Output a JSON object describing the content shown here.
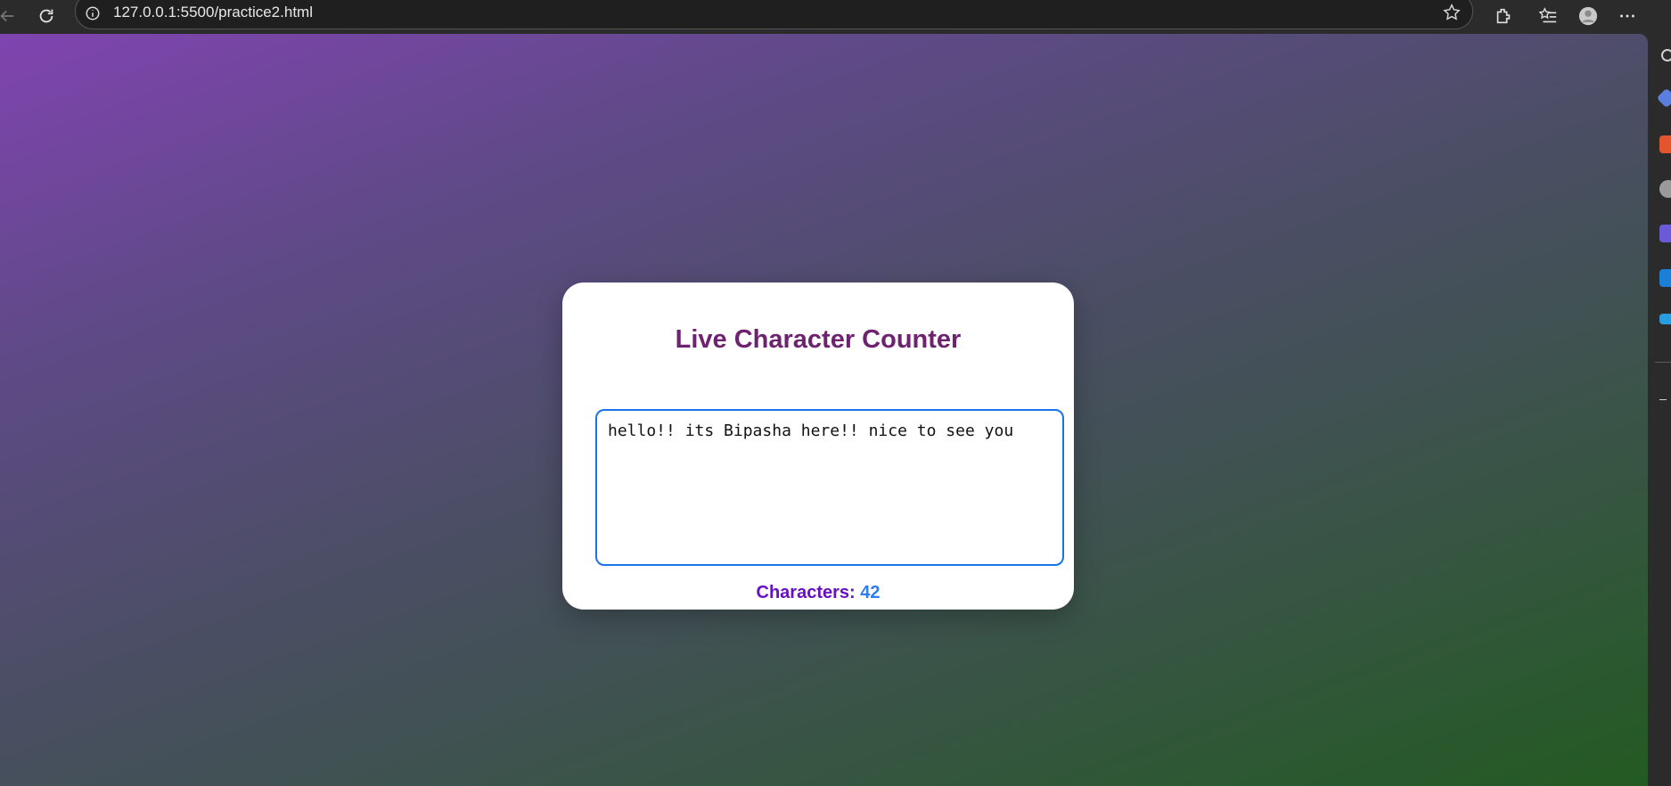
{
  "browser": {
    "url": "127.0.0.1:5500/practice2.html"
  },
  "page": {
    "title": "Live Character Counter",
    "textarea_value": "hello!! its Bipasha here!! nice to see you",
    "counter_label": "Characters:",
    "counter_value": "42"
  },
  "colors": {
    "title": "#6e2370",
    "counter_label": "#6610c4",
    "counter_value": "#2f7cf0",
    "textarea_border": "#1a73e8",
    "gradient_start": "#8044b0",
    "gradient_end": "#235a22"
  },
  "icons": {
    "toolbar": [
      "back-icon",
      "reload-icon",
      "info-icon",
      "star-icon",
      "extensions-icon",
      "favorites-icon",
      "profile-icon",
      "more-icon"
    ],
    "sidebar": [
      "search-icon",
      "copilot-icon",
      "shopping-icon",
      "people-icon",
      "games-icon",
      "outlook-icon",
      "send-icon",
      "add-icon"
    ]
  }
}
